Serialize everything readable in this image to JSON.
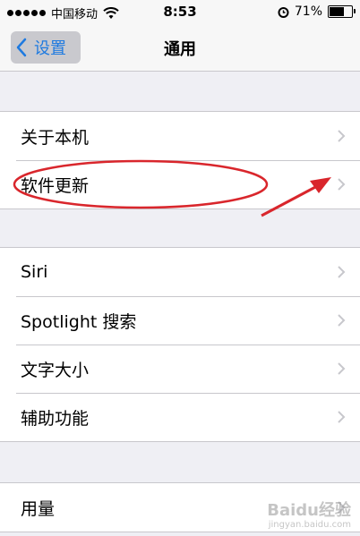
{
  "status_bar": {
    "carrier": "中国移动",
    "time": "8:53",
    "battery": "71%",
    "battery_level": 0.71
  },
  "nav": {
    "back_label": "设置",
    "title": "通用"
  },
  "groups": [
    {
      "items": [
        "关于本机",
        "软件更新"
      ]
    },
    {
      "items": [
        "Siri",
        "Spotlight 搜索",
        "文字大小",
        "辅助功能"
      ]
    },
    {
      "items": [
        "用量"
      ]
    }
  ],
  "watermark": {
    "logo_text": "Baidu经验",
    "url": "jingyan.baidu.com"
  },
  "colors": {
    "accent": "#1e7ae0",
    "annotation": "#d9262c"
  }
}
